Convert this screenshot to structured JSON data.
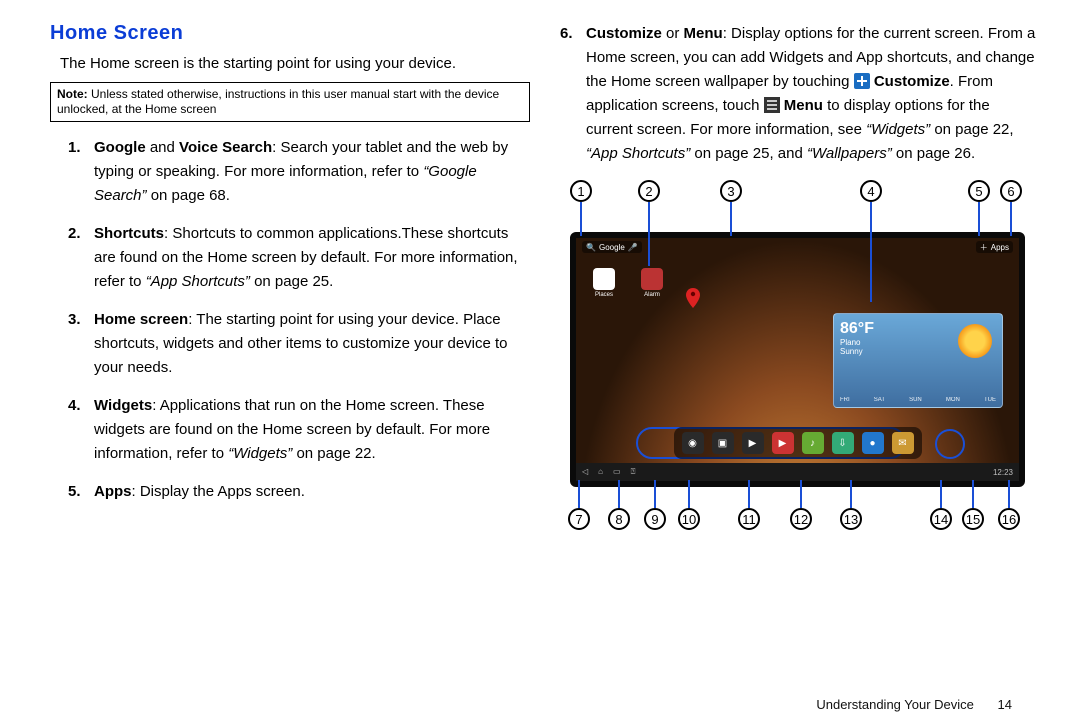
{
  "title": "Home Screen",
  "intro": "The Home screen is the starting point for using your device.",
  "note": {
    "label": "Note:",
    "text": "Unless stated otherwise, instructions in this user manual start with the device unlocked, at the Home screen"
  },
  "items": [
    {
      "n": "1.",
      "lead": "Google",
      "conj": " and ",
      "lead2": "Voice Search",
      "body": ": Search your tablet and the web by typing or speaking. For more information, refer to ",
      "ref": "“Google Search”",
      "tail": "  on page 68."
    },
    {
      "n": "2.",
      "lead": "Shortcuts",
      "body": ": Shortcuts to common applications.These shortcuts are found on the Home screen by default. For more information, refer to ",
      "ref": "“App Shortcuts”",
      "tail": "  on page 25."
    },
    {
      "n": "3.",
      "lead": "Home screen",
      "body": ": The starting point for using your device. Place shortcuts, widgets and other items to customize your device to your needs."
    },
    {
      "n": "4.",
      "lead": "Widgets",
      "body": ": Applications that run on the Home screen. These widgets are found on the Home screen by default. For more information, refer to ",
      "ref": "“Widgets”",
      "tail": "  on page 22."
    },
    {
      "n": "5.",
      "lead": "Apps",
      "body": ": Display the Apps screen."
    }
  ],
  "item6": {
    "n": "6.",
    "lead": "Customize",
    "conj": " or ",
    "lead2": "Menu",
    "bodyA": ": Display options for the current screen. From a Home screen, you can add Widgets and App shortcuts, and change the Home screen wallpaper by touching ",
    "inlineA": "Customize",
    "bodyB": ". From application screens, touch ",
    "inlineB": "Menu",
    "bodyC": " to display options for the current screen. For more information, see ",
    "ref1": "“Widgets”",
    "ref1tail": " on page 22, ",
    "ref2": "“App Shortcuts”",
    "ref2tail": " on page 25, and ",
    "ref3": "“Wallpapers”",
    "ref3tail": " on page 26."
  },
  "callouts_top": [
    "1",
    "2",
    "3",
    "4",
    "5",
    "6"
  ],
  "callouts_bottom": [
    "7",
    "8",
    "9",
    "10",
    "11",
    "12",
    "13",
    "14",
    "15",
    "16"
  ],
  "device": {
    "search_label": "Google",
    "apps_label": "Apps",
    "home_icons": [
      {
        "name": "Places",
        "color": "#ffffff"
      },
      {
        "name": "Alarm",
        "color": "#b33"
      }
    ],
    "weather": {
      "temp": "86°F",
      "city": "Plano",
      "cond": "Sunny",
      "days": [
        "FRI",
        "SAT",
        "SUN",
        "MON",
        "TUE"
      ]
    },
    "dock": [
      {
        "name": "Camera",
        "c": "#2a2a2a",
        "g": "◉"
      },
      {
        "name": "Gallery",
        "c": "#2a2a2a",
        "g": "▣"
      },
      {
        "name": "Video",
        "c": "#2a2a2a",
        "g": "▶"
      },
      {
        "name": "YouTube",
        "c": "#c33",
        "g": "▶"
      },
      {
        "name": "Music",
        "c": "#6a3",
        "g": "♪"
      },
      {
        "name": "Market",
        "c": "#3a7",
        "g": "⇩"
      },
      {
        "name": "Browser",
        "c": "#27c",
        "g": "●"
      },
      {
        "name": "Email",
        "c": "#c93",
        "g": "✉"
      }
    ],
    "time": "12:23"
  },
  "footer": {
    "section": "Understanding Your Device",
    "page": "14"
  }
}
